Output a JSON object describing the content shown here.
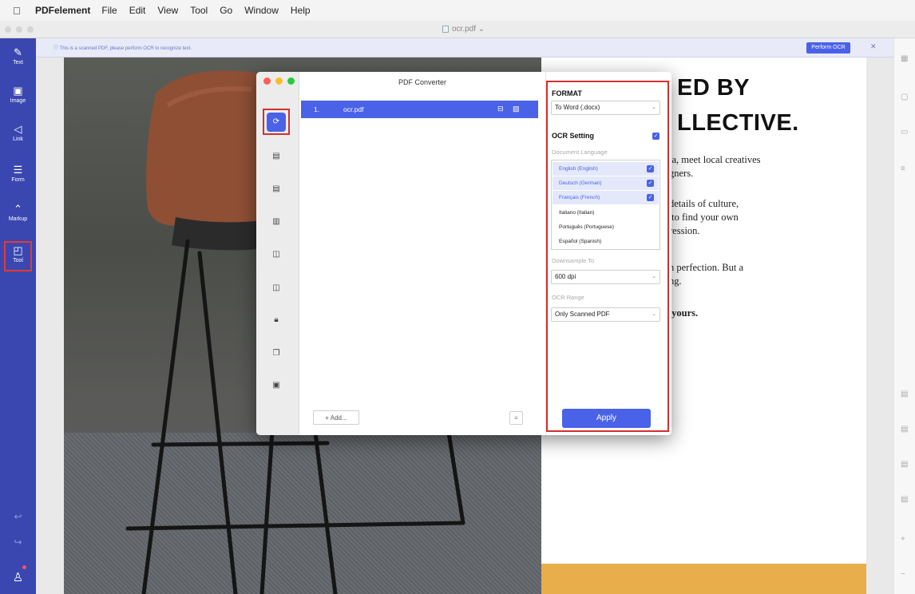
{
  "menubar": {
    "apple": "",
    "app_name": "PDFelement",
    "items": [
      "File",
      "Edit",
      "View",
      "Tool",
      "Go",
      "Window",
      "Help"
    ]
  },
  "window": {
    "doc_title": "ocr.pdf ⌄"
  },
  "banner": {
    "message": "ⓘ This is a scanned PDF, please perform OCR to recognize text.",
    "perform_ocr": "Perform OCR",
    "close": "✕"
  },
  "left_toolbar": {
    "tools": [
      {
        "label": "Text",
        "icon": "✎"
      },
      {
        "label": "Image",
        "icon": "▣"
      },
      {
        "label": "Link",
        "icon": "◁"
      },
      {
        "label": "Form",
        "icon": "☰"
      },
      {
        "label": "Markup",
        "icon": "⌃"
      },
      {
        "label": "Tool",
        "icon": "◰"
      }
    ],
    "undo": "↩",
    "redo": "↪",
    "account": "♙"
  },
  "document": {
    "headline_1": "ED BY",
    "headline_2": "LLECTIVE.",
    "para_1": "ia, meet local creatives\ngners.",
    "para_2": "details of culture,\n to find your own\nression.",
    "para_3": "n perfection. But a\nng.",
    "para_4": " yours."
  },
  "dialog": {
    "title": "PDF Converter",
    "file": {
      "index": "1.",
      "name": "ocr.pdf"
    },
    "add_button": "+ Add...",
    "format": {
      "label": "FORMAT",
      "selected": "To Word (.docx)"
    },
    "ocr": {
      "label": "OCR Setting",
      "checked": true,
      "doc_language_label": "Document Language",
      "languages": [
        {
          "name": "English (English)",
          "checked": true
        },
        {
          "name": "Deutsch (German)",
          "checked": true
        },
        {
          "name": "Français (French)",
          "checked": true
        },
        {
          "name": "Italiano (Italian)",
          "checked": false
        },
        {
          "name": "Português (Portuguese)",
          "checked": false
        },
        {
          "name": "Español (Spanish)",
          "checked": false
        }
      ],
      "downsample_label": "Downsample To",
      "downsample_value": "600 dpi",
      "range_label": "OCR Range",
      "range_value": "Only Scanned PDF"
    },
    "apply": "Apply"
  },
  "colors": {
    "accent": "#4a62e8",
    "sidebar": "#3a47b0",
    "highlight_box": "#d32f2f",
    "page_band": "#e8ae4b"
  }
}
